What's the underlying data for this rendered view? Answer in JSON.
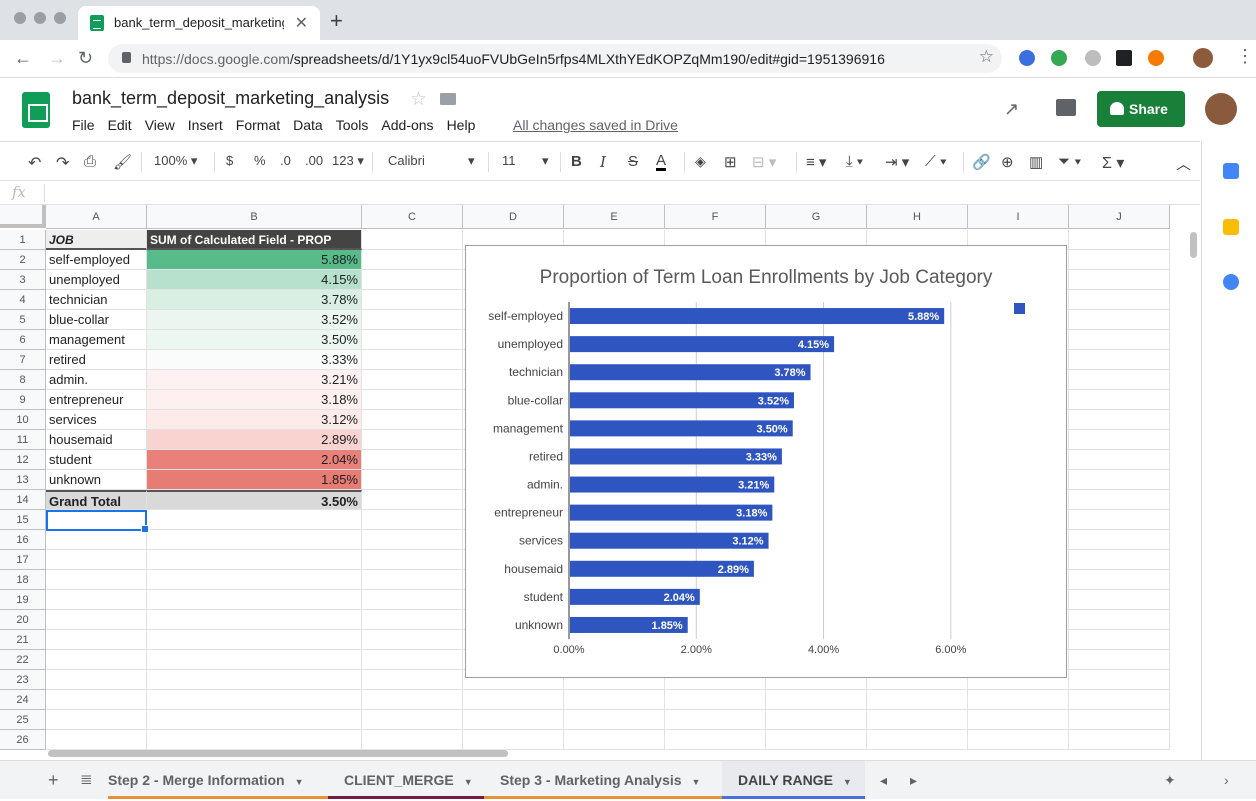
{
  "browser": {
    "tab_title": "bank_term_deposit_marketing_",
    "url_host": "https://docs.google.com",
    "url_path": "/spreadsheets/d/1Y1yx9cl54uoFVUbGeIn5rfps4MLXthYEdKOPZqMm190/edit#gid=1951396916"
  },
  "doc": {
    "title": "bank_term_deposit_marketing_analysis",
    "menu": [
      "File",
      "Edit",
      "View",
      "Insert",
      "Format",
      "Data",
      "Tools",
      "Add-ons",
      "Help"
    ],
    "saved_status": "All changes saved in Drive",
    "share_label": "Share"
  },
  "toolbar": {
    "zoom": "100%",
    "currency": "$",
    "percent": "%",
    "dec_less": ".0",
    "dec_more": ".00",
    "more_formats": "123",
    "font": "Calibri",
    "font_size": "11",
    "bold": "B",
    "italic": "I",
    "strike": "S",
    "text_color": "A",
    "formula_prefix": "fx"
  },
  "columns": [
    "A",
    "B",
    "C",
    "D",
    "E",
    "F",
    "G",
    "H",
    "I",
    "J"
  ],
  "rows": [
    "1",
    "2",
    "3",
    "4",
    "5",
    "6",
    "7",
    "8",
    "9",
    "10",
    "11",
    "12",
    "13",
    "14",
    "15",
    "16",
    "17",
    "18",
    "19",
    "20",
    "21",
    "22",
    "23",
    "24",
    "25",
    "26"
  ],
  "table": {
    "header_a": "JOB",
    "header_b": "SUM of Calculated Field - PROP",
    "rows": [
      {
        "job": "self-employed",
        "value": "5.88%",
        "color": "#57bb8a"
      },
      {
        "job": "unemployed",
        "value": "4.15%",
        "color": "#b7e1cd"
      },
      {
        "job": "technician",
        "value": "3.78%",
        "color": "#d9efe3"
      },
      {
        "job": "blue-collar",
        "value": "3.52%",
        "color": "#eaf6ef"
      },
      {
        "job": "management",
        "value": "3.50%",
        "color": "#ecf7f1"
      },
      {
        "job": "retired",
        "value": "3.33%",
        "color": "#f9fcfa"
      },
      {
        "job": "admin.",
        "value": "3.21%",
        "color": "#fdf2f1"
      },
      {
        "job": "entrepreneur",
        "value": "3.18%",
        "color": "#fdf0ef"
      },
      {
        "job": "services",
        "value": "3.12%",
        "color": "#fcebe9"
      },
      {
        "job": "housemaid",
        "value": "2.89%",
        "color": "#f8d3d0"
      },
      {
        "job": "student",
        "value": "2.04%",
        "color": "#e9817a"
      },
      {
        "job": "unknown",
        "value": "1.85%",
        "color": "#e67c73"
      }
    ],
    "total_label": "Grand Total",
    "total_value": "3.50%"
  },
  "chart_data": {
    "type": "bar",
    "orientation": "horizontal",
    "title": "Proportion of Term Loan Enrollments by Job Category",
    "categories": [
      "self-employed",
      "unemployed",
      "technician",
      "blue-collar",
      "management",
      "retired",
      "admin.",
      "entrepreneur",
      "services",
      "housemaid",
      "student",
      "unknown"
    ],
    "values": [
      5.88,
      4.15,
      3.78,
      3.52,
      3.5,
      3.33,
      3.21,
      3.18,
      3.12,
      2.89,
      2.04,
      1.85
    ],
    "value_labels": [
      "5.88%",
      "4.15%",
      "3.78%",
      "3.52%",
      "3.50%",
      "3.33%",
      "3.21%",
      "3.18%",
      "3.12%",
      "2.89%",
      "2.04%",
      "1.85%"
    ],
    "xticks": [
      "0.00%",
      "2.00%",
      "4.00%",
      "6.00%"
    ],
    "xlim": [
      0,
      6.6
    ],
    "grid": true,
    "legend": "top-right",
    "color": "#2f55c1"
  },
  "sheet_tabs": [
    {
      "label": "Step 2 - Merge Information",
      "color": "#e69138"
    },
    {
      "label": "CLIENT_MERGE",
      "color": "#741b47"
    },
    {
      "label": "Step 3 - Marketing Analysis",
      "color": "#e69138"
    },
    {
      "label": "DAILY RANGE",
      "color": "#4a6fdc"
    }
  ]
}
